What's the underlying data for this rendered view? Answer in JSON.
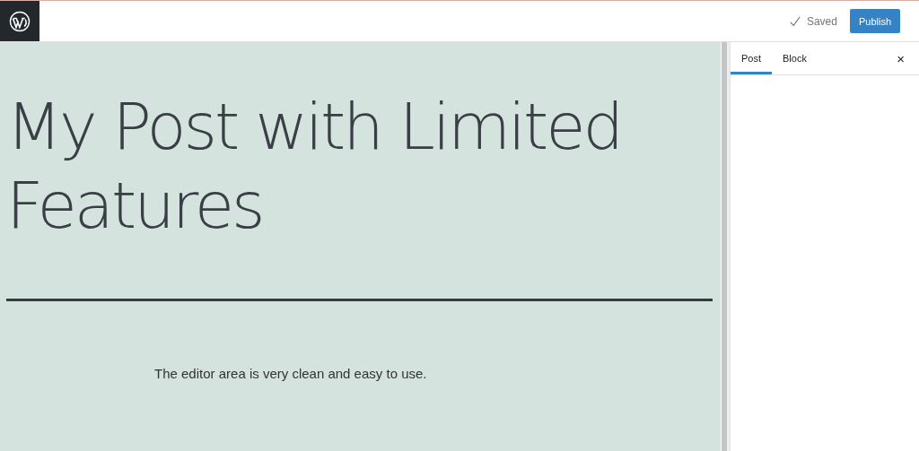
{
  "header": {
    "save_status": "Saved",
    "publish_button": "Publish"
  },
  "editor": {
    "title": "My Post with Limited Features",
    "paragraph": "The editor area is very clean and easy to use."
  },
  "sidebar": {
    "tabs": [
      {
        "label": "Post",
        "selected": true
      },
      {
        "label": "Block",
        "selected": false
      }
    ],
    "close": "×"
  }
}
